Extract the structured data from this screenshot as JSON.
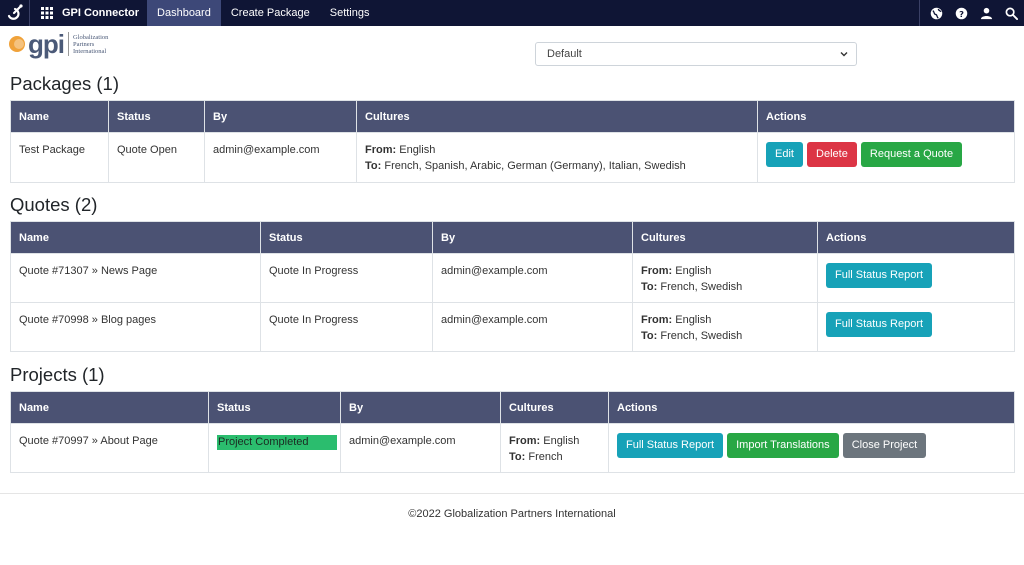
{
  "nav": {
    "app_name": "GPI Connector",
    "tabs": [
      "Dashboard",
      "Create Package",
      "Settings"
    ],
    "active_tab": "Dashboard",
    "icons": [
      "language-icon",
      "help-icon",
      "user-icon",
      "search-icon"
    ]
  },
  "brand": {
    "logo_text": "gpi",
    "line1": "Globalization",
    "line2": "Partners",
    "line3": "International"
  },
  "select": {
    "value": "Default"
  },
  "packages": {
    "title": "Packages (1)",
    "headers": [
      "Name",
      "Status",
      "By",
      "Cultures",
      "Actions"
    ],
    "rows": [
      {
        "name": "Test Package",
        "status": "Quote Open",
        "by": "admin@example.com",
        "from_label": "From:",
        "from": "English",
        "to_label": "To:",
        "to": "French, Spanish, Arabic, German (Germany), Italian, Swedish",
        "actions": [
          "Edit",
          "Delete",
          "Request a Quote"
        ]
      }
    ]
  },
  "quotes": {
    "title": "Quotes (2)",
    "headers": [
      "Name",
      "Status",
      "By",
      "Cultures",
      "Actions"
    ],
    "rows": [
      {
        "name": "Quote #71307 » News Page",
        "status": "Quote In Progress",
        "by": "admin@example.com",
        "from_label": "From:",
        "from": "English",
        "to_label": "To:",
        "to": "French, Swedish",
        "action": "Full Status Report"
      },
      {
        "name": "Quote #70998 » Blog pages",
        "status": "Quote In Progress",
        "by": "admin@example.com",
        "from_label": "From:",
        "from": "English",
        "to_label": "To:",
        "to": "French, Swedish",
        "action": "Full Status Report"
      }
    ]
  },
  "projects": {
    "title": "Projects (1)",
    "headers": [
      "Name",
      "Status",
      "By",
      "Cultures",
      "Actions"
    ],
    "rows": [
      {
        "name": "Quote #70997 » About Page",
        "status": "Project Completed",
        "by": "admin@example.com",
        "from_label": "From:",
        "from": "English",
        "to_label": "To:",
        "to": "French",
        "actions": [
          "Full Status Report",
          "Import Translations",
          "Close Project"
        ]
      }
    ]
  },
  "footer": {
    "text": "©2022 Globalization Partners International"
  }
}
